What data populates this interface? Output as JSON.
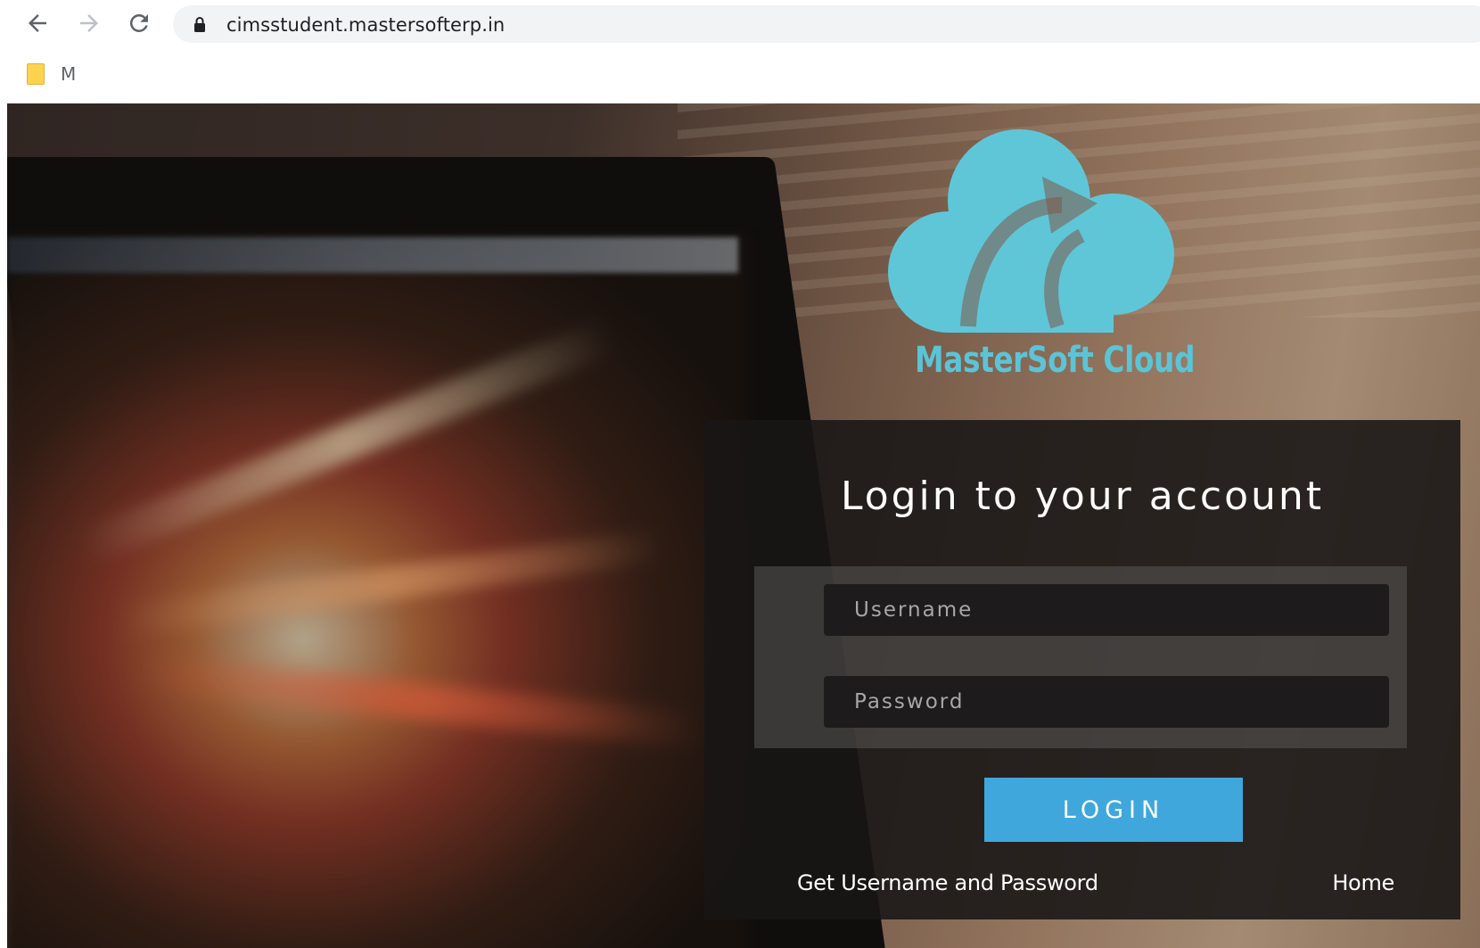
{
  "browser": {
    "url": "cimsstudent.mastersofterp.in",
    "bookmarks": [
      {
        "label": "M",
        "icon": "folder-icon"
      }
    ]
  },
  "brand": {
    "name": "MasterSoft Cloud",
    "logo_color": "#5bc4d6"
  },
  "login": {
    "title": "Login to your account",
    "username_placeholder": "Username",
    "password_placeholder": "Password",
    "button_label": "LOGIN",
    "button_color": "#3fa7dc",
    "forgot_link": "Get Username and Password",
    "home_link": "Home"
  }
}
